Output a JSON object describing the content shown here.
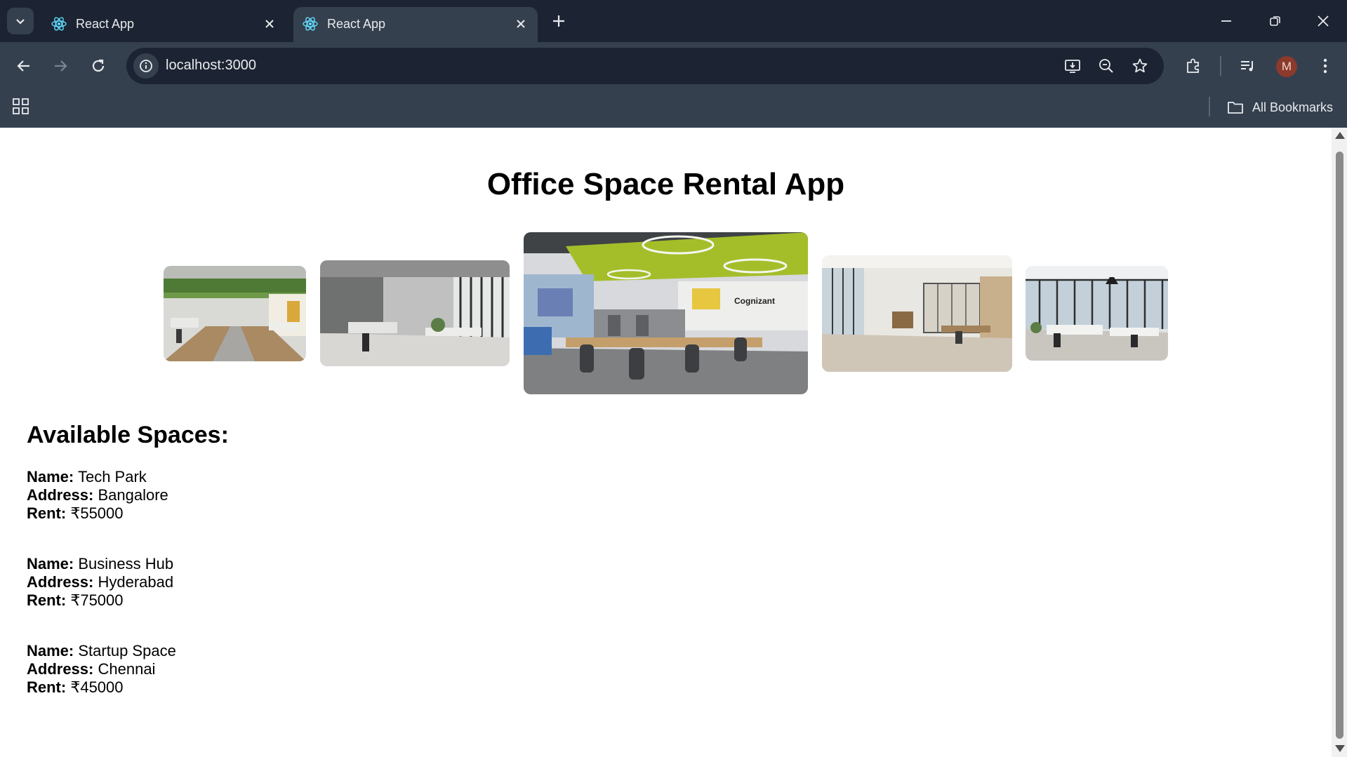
{
  "browser": {
    "tabs": [
      {
        "title": "React App",
        "active": false
      },
      {
        "title": "React App",
        "active": true
      }
    ],
    "url": "localhost:3000",
    "profile_initial": "M",
    "bookmarks_label": "All Bookmarks"
  },
  "page": {
    "title": "Office Space Rental App",
    "gallery_images": [
      {
        "name": "office-photo-1",
        "description": "open office with plant ceiling"
      },
      {
        "name": "office-photo-2",
        "description": "grey office with windows"
      },
      {
        "name": "office-photo-3",
        "description": "Cognizant accelerator workspace"
      },
      {
        "name": "office-photo-4",
        "description": "empty office with glass room"
      },
      {
        "name": "office-photo-5",
        "description": "bright open-plan office"
      }
    ],
    "office_sign_text": "Cognizant",
    "spaces_heading": "Available Spaces:",
    "labels": {
      "name": "Name:",
      "address": "Address:",
      "rent": "Rent:"
    },
    "spaces": [
      {
        "name": "Tech Park",
        "address": "Bangalore",
        "rent": "₹55000"
      },
      {
        "name": "Business Hub",
        "address": "Hyderabad",
        "rent": "₹75000"
      },
      {
        "name": "Startup Space",
        "address": "Chennai",
        "rent": "₹45000"
      }
    ]
  },
  "colors": {
    "tabstrip": "#1c2433",
    "toolbar": "#35404f",
    "text_light": "#e8eaed",
    "accent_green": "#a4be2a"
  }
}
